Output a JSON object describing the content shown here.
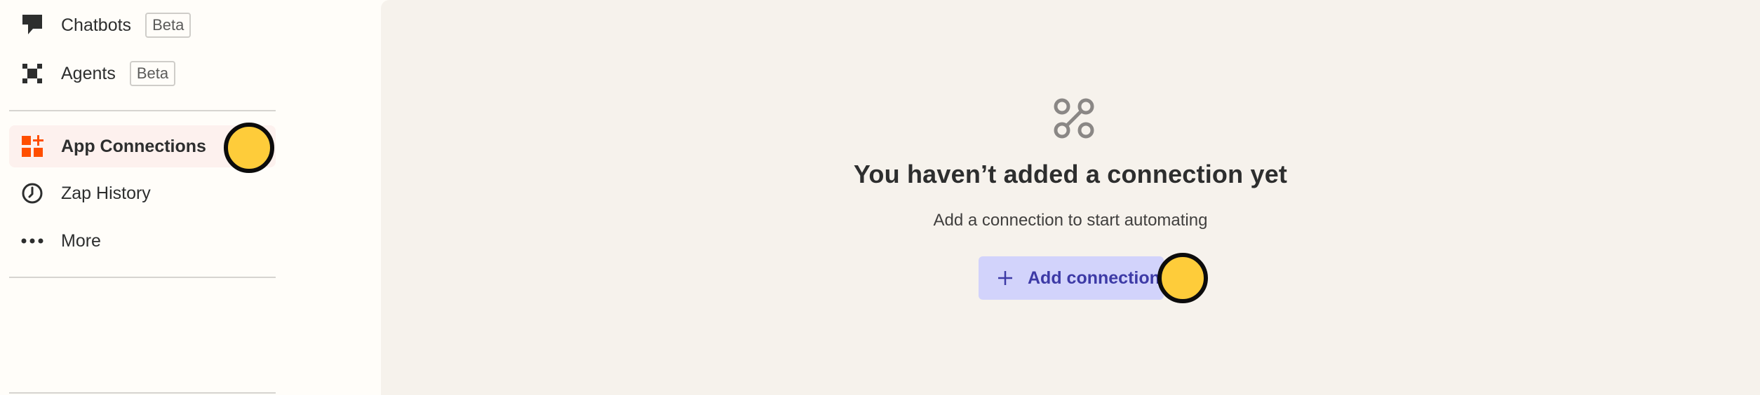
{
  "sidebar": {
    "items": [
      {
        "label": "Chatbots",
        "badge": "Beta",
        "icon": "chatbot-icon"
      },
      {
        "label": "Agents",
        "badge": "Beta",
        "icon": "agents-icon"
      },
      {
        "label": "App Connections",
        "icon": "app-connections-icon",
        "active": true
      },
      {
        "label": "Zap History",
        "icon": "clock-icon"
      },
      {
        "label": "More",
        "icon": "more-dots-icon"
      }
    ]
  },
  "main": {
    "empty_state": {
      "icon": "connection-icon",
      "title": "You haven’t added a connection yet",
      "subtitle": "Add a connection to start automating",
      "button_label": "Add connection",
      "button_icon": "plus-icon"
    }
  },
  "colors": {
    "accent": "#ff4f00",
    "button_bg": "#d2d3fb",
    "button_text": "#3d3aa6",
    "marker": "#fecc3a"
  }
}
